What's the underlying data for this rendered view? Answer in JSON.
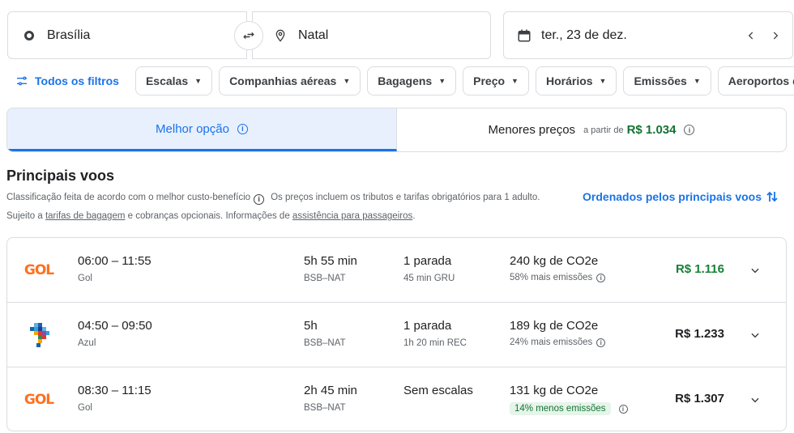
{
  "search": {
    "origin": "Brasília",
    "destination": "Natal",
    "date": "ter., 23 de dez."
  },
  "filters": {
    "all_filters": "Todos os filtros",
    "chips": [
      "Escalas",
      "Companhias aéreas",
      "Bagagens",
      "Preço",
      "Horários",
      "Emissões",
      "Aeroportos de con"
    ]
  },
  "tabs": {
    "best": "Melhor opção",
    "cheapest": "Menores preços",
    "from_label": "a partir de",
    "cheapest_price": "R$ 1.034"
  },
  "heading": {
    "title": "Principais voos",
    "sub1_a": "Classificação feita de acordo com o melhor custo-benefício",
    "sub1_b": "Os preços incluem os tributos e tarifas obrigatórios para 1 adulto.",
    "sub2_a": "Sujeito a",
    "sub2_link1": "tarifas de bagagem",
    "sub2_b": "e cobranças opcionais. Informações de",
    "sub2_link2": "assistência para passageiros",
    "sub2_c": ".",
    "sort": "Ordenados pelos principais voos"
  },
  "flights": [
    {
      "times": "06:00 – 11:55",
      "airline": "Gol",
      "logo": "GOL",
      "duration": "5h 55 min",
      "route": "BSB–NAT",
      "stops": "1 parada",
      "stop_info": "45 min GRU",
      "co2": "240 kg de CO2e",
      "co2_note": "58% mais emissões",
      "price": "R$ 1.116"
    },
    {
      "times": "04:50 – 09:50",
      "airline": "Azul",
      "logo": "",
      "duration": "5h",
      "route": "BSB–NAT",
      "stops": "1 parada",
      "stop_info": "1h 20 min REC",
      "co2": "189 kg de CO2e",
      "co2_note": "24% mais emissões",
      "price": "R$ 1.233"
    },
    {
      "times": "08:30 – 11:15",
      "airline": "Gol",
      "logo": "GOL",
      "duration": "2h 45 min",
      "route": "BSB–NAT",
      "stops": "Sem escalas",
      "stop_info": "",
      "co2": "131 kg de CO2e",
      "co2_note": "14% menos emissões",
      "price": "R$ 1.307"
    }
  ],
  "colors": {
    "accent": "#1a73e8",
    "price_green": "#188038",
    "gol_orange": "#ff7020",
    "less_emissions_bg": "#e6f4ea"
  }
}
